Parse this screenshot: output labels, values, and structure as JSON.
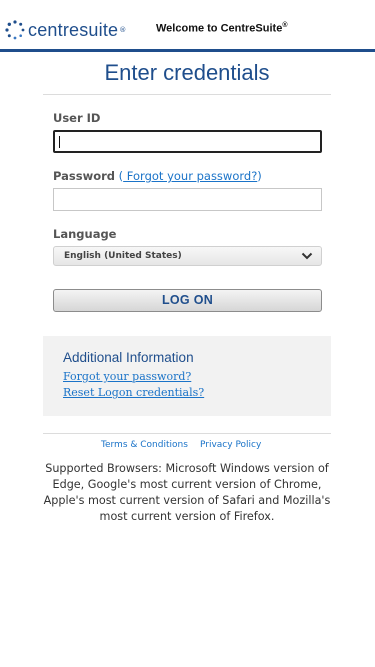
{
  "header": {
    "logo_text_bold": "centre",
    "logo_text_light": "suite",
    "logo_tm": "®",
    "welcome": "Welcome to CentreSuite",
    "welcome_reg": "®"
  },
  "page": {
    "title": "Enter credentials"
  },
  "form": {
    "user_id_label": "User ID",
    "user_id_value": "",
    "password_label": "Password",
    "forgot_password_open": " (",
    "forgot_password_link": " Forgot your password?",
    "forgot_password_close": ")",
    "password_value": "",
    "language_label": "Language",
    "language_selected": "English (United States)",
    "logon_button": "LOG ON"
  },
  "additional_info": {
    "title": "Additional Information",
    "links": [
      "Forgot your password?",
      "Reset Logon credentials?"
    ]
  },
  "footer": {
    "links": [
      "Terms & Conditions",
      "Privacy Policy"
    ],
    "supported_browsers": "Supported Browsers: Microsoft Windows version of Edge, Google's most current version of Chrome, Apple's most current version of Safari and Mozilla's most current version of Firefox."
  },
  "colors": {
    "brand_blue": "#1f4e8c",
    "link_blue": "#1a73c8",
    "panel_gray": "#f2f2f2"
  },
  "icons": {
    "logo": "dotted-circle-logo-icon",
    "select": "chevron-down-icon"
  }
}
